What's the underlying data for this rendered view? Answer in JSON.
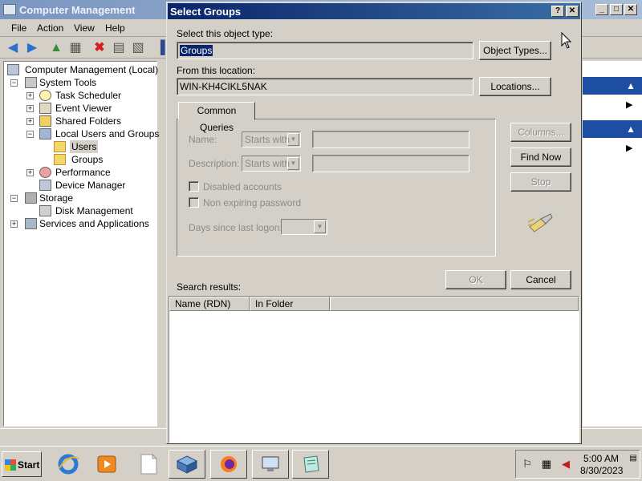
{
  "background_window": {
    "title": "Computer Management",
    "menu": [
      "File",
      "Action",
      "View",
      "Help"
    ],
    "tree": [
      {
        "label": "Computer Management (Local)",
        "icon": "computer-icon"
      },
      {
        "label": "System Tools",
        "icon": "tools-icon"
      },
      {
        "label": "Task Scheduler",
        "icon": "clock-icon"
      },
      {
        "label": "Event Viewer",
        "icon": "event-viewer-icon"
      },
      {
        "label": "Shared Folders",
        "icon": "shared-folder-icon"
      },
      {
        "label": "Local Users and Groups",
        "icon": "users-icon"
      },
      {
        "label": "Users",
        "icon": "folder-icon"
      },
      {
        "label": "Groups",
        "icon": "folder-icon"
      },
      {
        "label": "Performance",
        "icon": "performance-icon"
      },
      {
        "label": "Device Manager",
        "icon": "device-manager-icon"
      },
      {
        "label": "Storage",
        "icon": "storage-icon"
      },
      {
        "label": "Disk Management",
        "icon": "disk-icon"
      },
      {
        "label": "Services and Applications",
        "icon": "services-icon"
      }
    ]
  },
  "dialog": {
    "title": "Select Groups",
    "help_symbol": "?",
    "close_symbol": "✕",
    "object_type_label": "Select this object type:",
    "object_type_value": "Groups",
    "object_types_button": "Object Types...",
    "location_label": "From this location:",
    "location_value": "WIN-KH4CIKL5NAK",
    "locations_button": "Locations...",
    "tab_label": "Common Queries",
    "name_label": "Name:",
    "name_op": "Starts with",
    "description_label": "Description:",
    "description_op": "Starts with",
    "disabled_accounts_label": "Disabled accounts",
    "non_expiring_label": "Non expiring password",
    "days_label": "Days since last logon:",
    "columns_button": "Columns...",
    "find_now_button": "Find Now",
    "stop_button": "Stop",
    "ok_button": "OK",
    "cancel_button": "Cancel",
    "search_results_label": "Search results:",
    "columns": [
      "Name (RDN)",
      "In Folder"
    ]
  },
  "taskbar": {
    "start_label": "Start",
    "clock_time": "5:00 AM",
    "clock_date": "8/30/2023"
  },
  "colors": {
    "dialog_title_start": "#0a246a",
    "dialog_title_end": "#3a6ea5",
    "action_header": "#1f4fa3",
    "face": "#d4d0c8"
  }
}
